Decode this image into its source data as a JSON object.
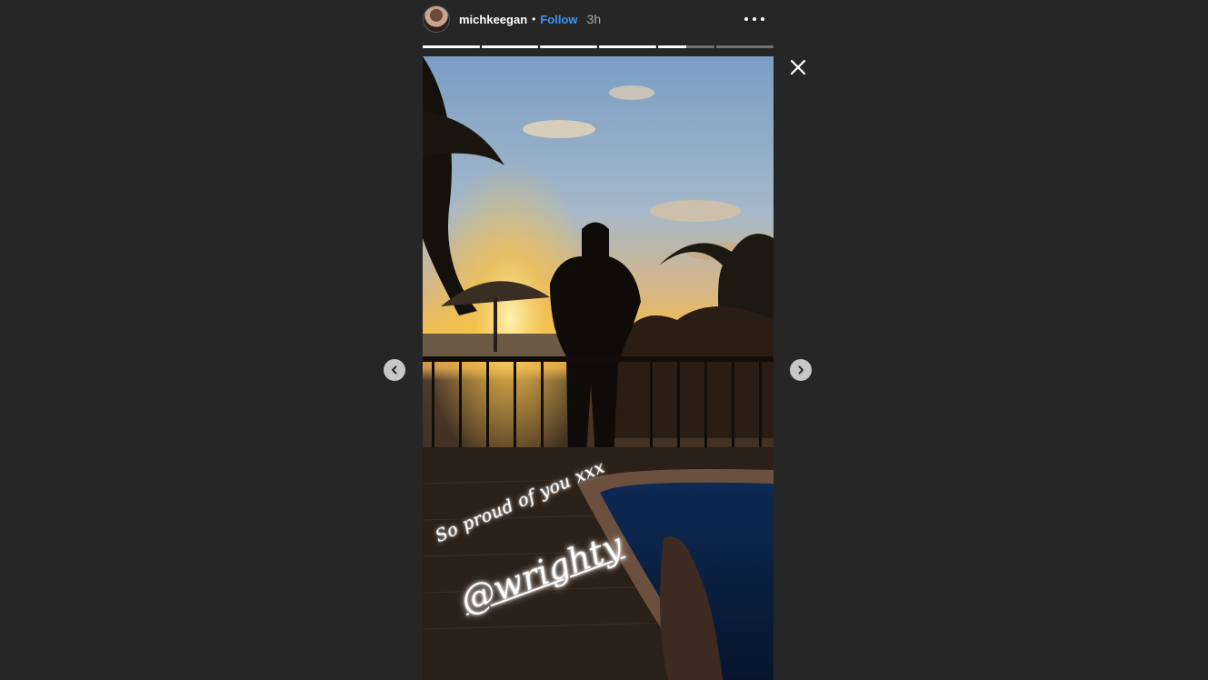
{
  "story": {
    "username": "michkeegan",
    "separator": "•",
    "follow_label": "Follow",
    "time": "3h",
    "more_icon": "more-options-icon",
    "caption_line": "So proud of you xxx",
    "mention": "@wrighty",
    "progress": [
      1,
      1,
      1,
      1,
      0.5,
      0
    ]
  },
  "controls": {
    "close_icon": "close-icon",
    "prev_icon": "chevron-left-icon",
    "next_icon": "chevron-right-icon"
  },
  "colors": {
    "background": "#262626",
    "follow": "#3897f0",
    "nav_button": "#c7c7c7"
  }
}
